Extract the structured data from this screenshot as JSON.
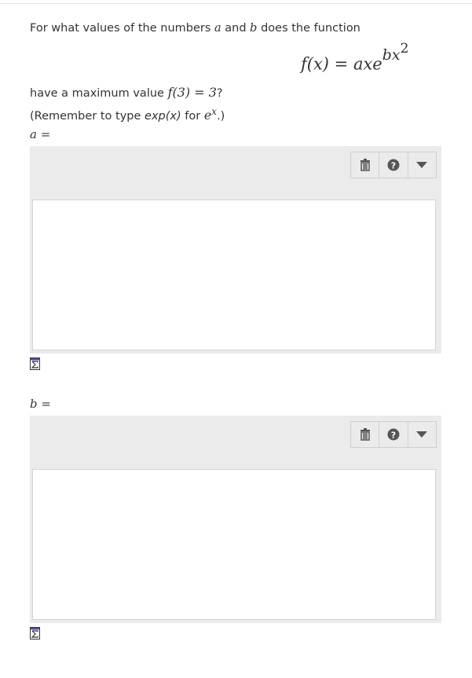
{
  "question": {
    "intro_1": "For what values of the numbers ",
    "var_a": "a",
    "intro_and": " and ",
    "var_b": "b",
    "intro_2": " does the function",
    "formula_lhs": "f(x) = axe",
    "formula_exp": "bx",
    "formula_exp_power": "2",
    "line2_prefix": "have a maximum value ",
    "line2_math": "f(3) = 3",
    "line2_suffix": "?",
    "line3_prefix": "(Remember to type ",
    "line3_code": "exp(x)",
    "line3_mid": " for ",
    "line3_math_base": "e",
    "line3_math_exp": "x",
    "line3_suffix": ".)"
  },
  "answers": [
    {
      "label": "a =",
      "value": ""
    },
    {
      "label": "b =",
      "value": ""
    }
  ],
  "toolbar": {
    "icons": [
      "trash-icon",
      "help-icon",
      "dropdown-icon"
    ]
  },
  "colors": {
    "editor_bg": "#ebebeb",
    "icon": "#555555",
    "border": "#cfcfcf"
  }
}
